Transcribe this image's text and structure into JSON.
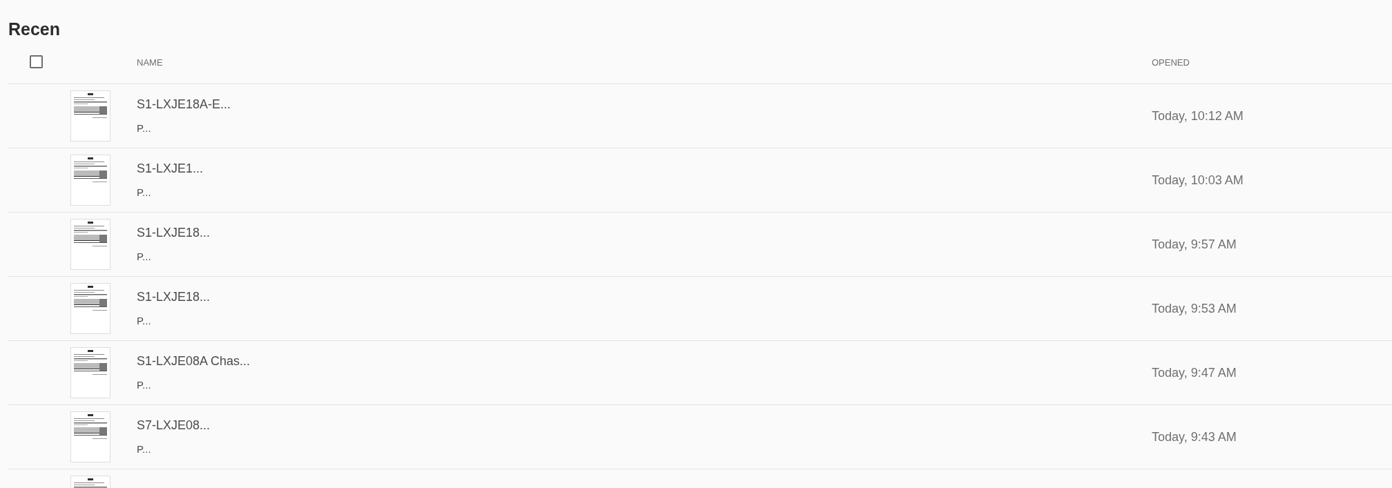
{
  "title": "Recen",
  "table": {
    "select_all": {
      "checked": false
    },
    "columns": [
      "NAME",
      "OPENED"
    ],
    "rows": [
      {
        "name": "S1-LXJE18A-E...",
        "subtitle": "P...",
        "opened": "Today, 10:12 AM"
      },
      {
        "name": "S1-LXJE1...",
        "subtitle": "P...",
        "opened": "Today, 10:03 AM"
      },
      {
        "name": "S1-LXJE18...",
        "subtitle": "P...",
        "opened": "Today, 9:57 AM"
      },
      {
        "name": "S1-LXJE18...",
        "subtitle": "P...",
        "opened": "Today, 9:53 AM"
      },
      {
        "name": "S1-LXJE08A Chas...",
        "subtitle": "P...",
        "opened": "Today, 9:47 AM"
      },
      {
        "name": "S7-LXJE08...",
        "subtitle": "P...",
        "opened": "Today, 9:43 AM"
      },
      {}
    ]
  }
}
